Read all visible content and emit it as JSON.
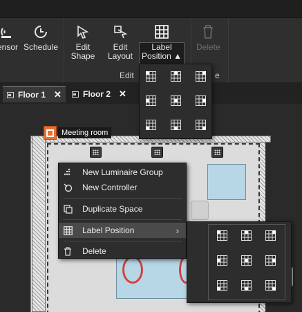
{
  "ribbon": {
    "sensor_label": "ensor",
    "schedule_label": "Schedule",
    "edit_shape_label": "Edit Shape",
    "edit_layout_label": "Edit Layout",
    "label_position_label": "Label Position ▲",
    "delete_label": "Delete",
    "group_edit": "Edit",
    "group_e": "e"
  },
  "tabs": [
    {
      "label": "Floor 1"
    },
    {
      "label": "Floor 2"
    }
  ],
  "room_label": "Meeting room",
  "context_menu": {
    "items": [
      {
        "label": "New Luminaire Group",
        "icon": "luminaire-group-icon"
      },
      {
        "label": "New Controller",
        "icon": "controller-icon"
      },
      {
        "label": "Duplicate Space",
        "icon": "duplicate-icon"
      },
      {
        "label": "Label Position",
        "icon": "label-position-icon"
      },
      {
        "label": "Delete",
        "icon": "trash-icon"
      }
    ]
  },
  "label_positions": [
    "top-left",
    "top-center",
    "top-right",
    "middle-left",
    "middle-center",
    "middle-right",
    "bottom-left",
    "bottom-center",
    "bottom-right"
  ],
  "colors": {
    "accent_orange": "#e9702f",
    "chair_red": "#d14141",
    "table_blue": "#b7d7e6"
  }
}
